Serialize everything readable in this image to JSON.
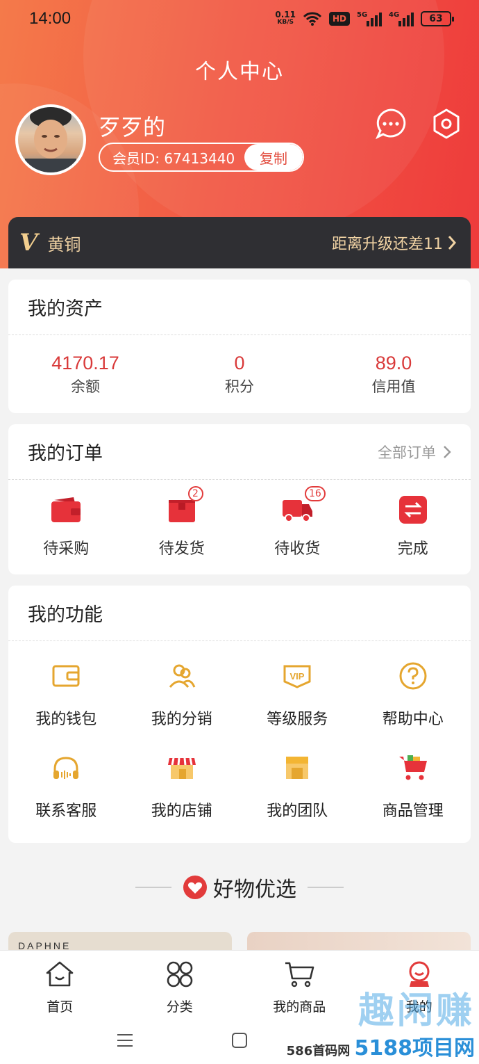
{
  "status_bar": {
    "time": "14:00",
    "net_speed": "0.11",
    "net_unit": "KB/S",
    "hd": "HD",
    "sig1": "5G",
    "sig2": "4G",
    "battery": "63"
  },
  "header": {
    "title": "个人中心",
    "username": "歹歹的",
    "member_id_label": "会员ID: 67413440",
    "copy_label": "复制"
  },
  "vip": {
    "logo": "V",
    "level": "黄铜",
    "upgrade_text": "距离升级还差11"
  },
  "assets": {
    "title": "我的资产",
    "items": [
      {
        "value": "4170.17",
        "label": "余额"
      },
      {
        "value": "0",
        "label": "积分"
      },
      {
        "value": "89.0",
        "label": "信用值"
      }
    ]
  },
  "orders": {
    "title": "我的订单",
    "all_label": "全部订单",
    "items": [
      {
        "label": "待采购",
        "icon": "wallet-icon",
        "badge": ""
      },
      {
        "label": "待发货",
        "icon": "package-icon",
        "badge": "2"
      },
      {
        "label": "待收货",
        "icon": "truck-icon",
        "badge": "16"
      },
      {
        "label": "完成",
        "icon": "exchange-icon",
        "badge": ""
      }
    ]
  },
  "functions": {
    "title": "我的功能",
    "items": [
      {
        "label": "我的钱包",
        "icon": "wallet-icon"
      },
      {
        "label": "我的分销",
        "icon": "users-icon"
      },
      {
        "label": "等级服务",
        "icon": "vip-icon"
      },
      {
        "label": "帮助中心",
        "icon": "help-icon"
      },
      {
        "label": "联系客服",
        "icon": "headset-icon"
      },
      {
        "label": "我的店铺",
        "icon": "store-icon"
      },
      {
        "label": "我的团队",
        "icon": "team-store-icon"
      },
      {
        "label": "商品管理",
        "icon": "cart-icon"
      }
    ]
  },
  "featured": {
    "title": "好物优选",
    "brand": "DAPHNE"
  },
  "tabbar": {
    "items": [
      {
        "label": "首页",
        "icon": "home-icon"
      },
      {
        "label": "分类",
        "icon": "grid-icon"
      },
      {
        "label": "我的商品",
        "icon": "cart-icon"
      },
      {
        "label": "我的",
        "icon": "profile-icon"
      }
    ]
  },
  "watermark": {
    "big": "趣闲赚",
    "small": "586首码网",
    "brand": "5188项目网"
  },
  "colors": {
    "accent": "#e23b3b",
    "header_start": "#f47a4a",
    "header_end": "#ee3b3b",
    "vip_bar": "#2f2f33",
    "vip_gold": "#f1d3a4",
    "func_icon": "#e5a62f"
  }
}
